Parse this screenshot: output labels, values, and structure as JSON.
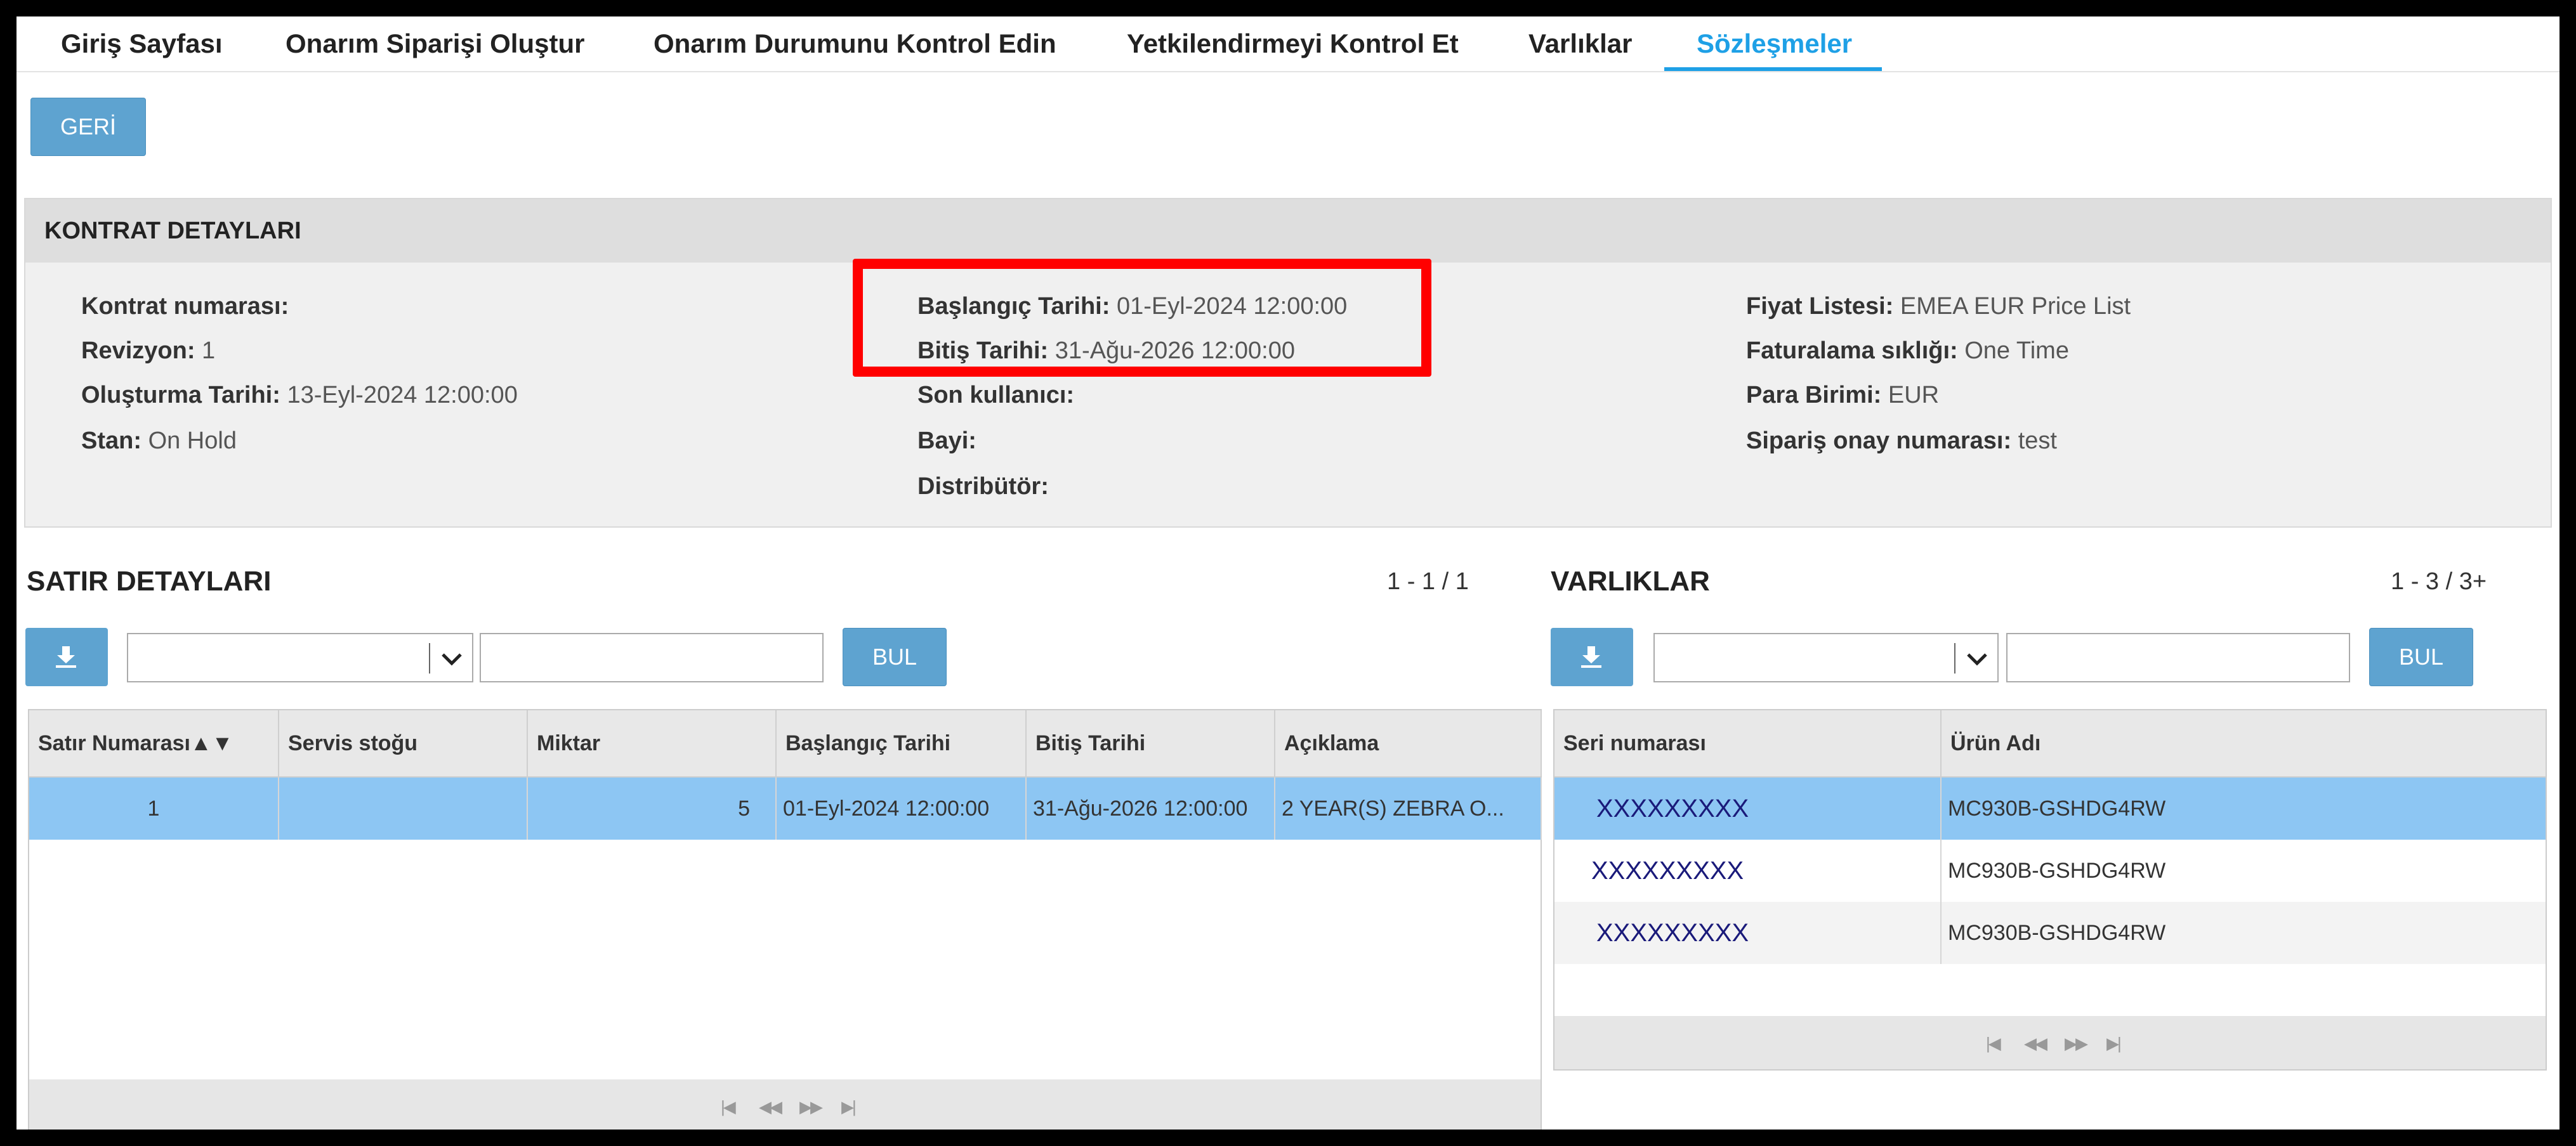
{
  "nav": {
    "items": [
      {
        "label": "Giriş Sayfası"
      },
      {
        "label": "Onarım Siparişi Oluştur"
      },
      {
        "label": "Onarım Durumunu Kontrol Edin"
      },
      {
        "label": "Yetkilendirmeyi Kontrol Et"
      },
      {
        "label": "Varlıklar"
      },
      {
        "label": "Sözleşmeler"
      }
    ],
    "active_index": 5
  },
  "back_button": {
    "label": "GERİ"
  },
  "contract": {
    "title": "KONTRAT DETAYLARI",
    "contract_number": {
      "label": "Kontrat numarası:",
      "value": ""
    },
    "revision": {
      "label": "Revizyon:",
      "value": "1"
    },
    "created": {
      "label": "Oluşturma Tarihi:",
      "value": "13-Eyl-2024 12:00:00"
    },
    "status": {
      "label": "Stan:",
      "value": "On Hold"
    },
    "start_date": {
      "label": "Başlangıç Tarihi:",
      "value": "01-Eyl-2024 12:00:00"
    },
    "end_date": {
      "label": "Bitiş Tarihi:",
      "value": "31-Ağu-2026 12:00:00"
    },
    "end_user": {
      "label": "Son kullanıcı:",
      "value": ""
    },
    "dealer": {
      "label": "Bayi:",
      "value": ""
    },
    "distributor": {
      "label": "Distribütör:",
      "value": ""
    },
    "price_list": {
      "label": "Fiyat Listesi:",
      "value": "EMEA EUR Price List"
    },
    "billing_frequency": {
      "label": "Faturalama sıklığı:",
      "value": "One Time"
    },
    "currency": {
      "label": "Para Birimi:",
      "value": "EUR"
    },
    "order_confirmation": {
      "label": "Sipariş onay numarası:",
      "value": "test"
    }
  },
  "line_details": {
    "title": "SATIR DETAYLARI",
    "pager": "1 - 1 / 1",
    "search_button": "BUL",
    "columns": [
      "Satır Numarası",
      "Servis stoğu",
      "Miktar",
      "Başlangıç Tarihi",
      "Bitiş Tarihi",
      "Açıklama"
    ],
    "sort_indicator": "▲▼",
    "rows": [
      {
        "line": "1",
        "service_stock": "",
        "quantity": "5",
        "start": "01-Eyl-2024 12:00:00",
        "end": "31-Ağu-2026 12:00:00",
        "description": "2 YEAR(S) ZEBRA O..."
      }
    ]
  },
  "assets": {
    "title": "VARLIKLAR",
    "pager": "1 - 3 / 3+",
    "search_button": "BUL",
    "columns": [
      "Seri numarası",
      "Ürün Adı"
    ],
    "rows": [
      {
        "serial": "XXXXXXXXX",
        "product": "MC930B-GSHDG4RW"
      },
      {
        "serial": "XXXXXXXXX",
        "product": "MC930B-GSHDG4RW"
      },
      {
        "serial": "XXXXXXXXX",
        "product": "MC930B-GSHDG4RW"
      }
    ]
  },
  "colors": {
    "accent": "#1ea0e6",
    "button": "#5ea3d0",
    "selected_row": "#8dc6f3",
    "highlight": "#ff0000"
  }
}
